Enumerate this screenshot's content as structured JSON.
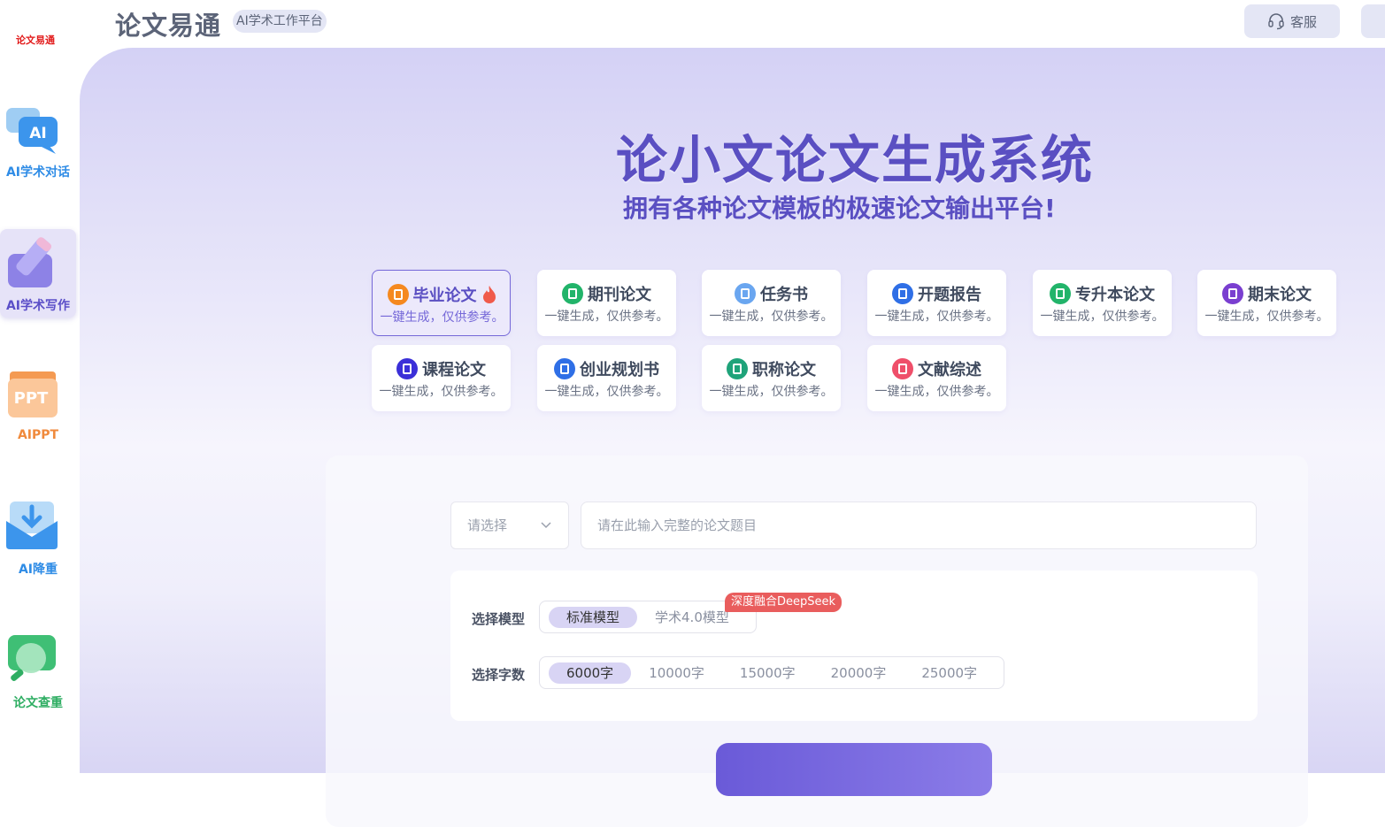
{
  "sidebar": {
    "logo_text": "论文易通",
    "items": [
      {
        "label": "AI学术对话",
        "icon": "ai-chat-icon",
        "color": "#2f8ce6"
      },
      {
        "label": "AI学术写作",
        "icon": "pen-icon",
        "color": "#5b4fc8"
      },
      {
        "label": "AIPPT",
        "icon": "ppt-icon",
        "color": "#f08a3c"
      },
      {
        "label": "AI降重",
        "icon": "download-mail-icon",
        "color": "#2f8ce6"
      },
      {
        "label": "论文查重",
        "icon": "magnifier-icon",
        "color": "#2fae63"
      }
    ]
  },
  "header": {
    "brand": "论文易通",
    "tag": "AI学术工作平台",
    "service_label": "客服"
  },
  "hero": {
    "title": "论小文论文生成系统",
    "subtitle": "拥有各种论文模板的极速论文输出平台!"
  },
  "cards": [
    {
      "title": "毕业论文",
      "sub": "一键生成，仅供参考。",
      "icon_color": "#f5891f",
      "hot": true
    },
    {
      "title": "期刊论文",
      "sub": "一键生成，仅供参考。",
      "icon_color": "#22b46a"
    },
    {
      "title": "任务书",
      "sub": "一键生成，仅供参考。",
      "icon_color": "#6aa6f0"
    },
    {
      "title": "开题报告",
      "sub": "一键生成，仅供参考。",
      "icon_color": "#2f6fe6"
    },
    {
      "title": "专升本论文",
      "sub": "一键生成，仅供参考。",
      "icon_color": "#22b46a"
    },
    {
      "title": "期末论文",
      "sub": "一键生成，仅供参考。",
      "icon_color": "#7a3fd0"
    },
    {
      "title": "课程论文",
      "sub": "一键生成，仅供参考。",
      "icon_color": "#3b2fd8"
    },
    {
      "title": "创业规划书",
      "sub": "一键生成，仅供参考。",
      "icon_color": "#2f6fe6"
    },
    {
      "title": "职称论文",
      "sub": "一键生成，仅供参考。",
      "icon_color": "#1fa37a"
    },
    {
      "title": "文献综述",
      "sub": "一键生成，仅供参考。",
      "icon_color": "#ef4f6a"
    }
  ],
  "form": {
    "select_placeholder": "请选择",
    "title_placeholder": "请在此输入完整的论文题目",
    "model_label": "选择模型",
    "models": [
      "标准模型",
      "学术4.0模型"
    ],
    "model_badge": "深度融合DeepSeek",
    "words_label": "选择字数",
    "words": [
      "6000字",
      "10000字",
      "15000字",
      "20000字",
      "25000字"
    ]
  }
}
